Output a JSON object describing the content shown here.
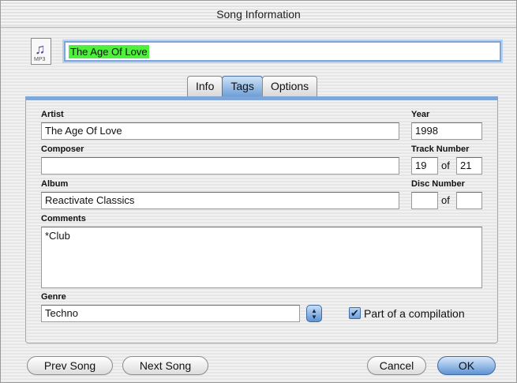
{
  "window": {
    "title": "Song Information"
  },
  "header": {
    "file_icon_ext": "MP3",
    "song_title": "The Age Of Love"
  },
  "tabs": [
    {
      "label": "Info",
      "active": false
    },
    {
      "label": "Tags",
      "active": true
    },
    {
      "label": "Options",
      "active": false
    }
  ],
  "fields": {
    "artist": {
      "label": "Artist",
      "value": "The Age Of Love"
    },
    "year": {
      "label": "Year",
      "value": "1998"
    },
    "composer": {
      "label": "Composer",
      "value": ""
    },
    "track_number": {
      "label": "Track Number",
      "value": "19",
      "of_label": "of",
      "total": "21"
    },
    "album": {
      "label": "Album",
      "value": "Reactivate Classics"
    },
    "disc_number": {
      "label": "Disc Number",
      "value": "",
      "of_label": "of",
      "total": ""
    },
    "comments": {
      "label": "Comments",
      "value": "*Club"
    },
    "genre": {
      "label": "Genre",
      "value": "Techno"
    },
    "compilation": {
      "label": "Part of a compilation",
      "checked": true,
      "check_glyph": "✔"
    }
  },
  "buttons": {
    "prev": "Prev Song",
    "next": "Next Song",
    "cancel": "Cancel",
    "ok": "OK"
  },
  "colors": {
    "accent": "#7ea6d9",
    "selection_highlight": "#4ef03b"
  }
}
